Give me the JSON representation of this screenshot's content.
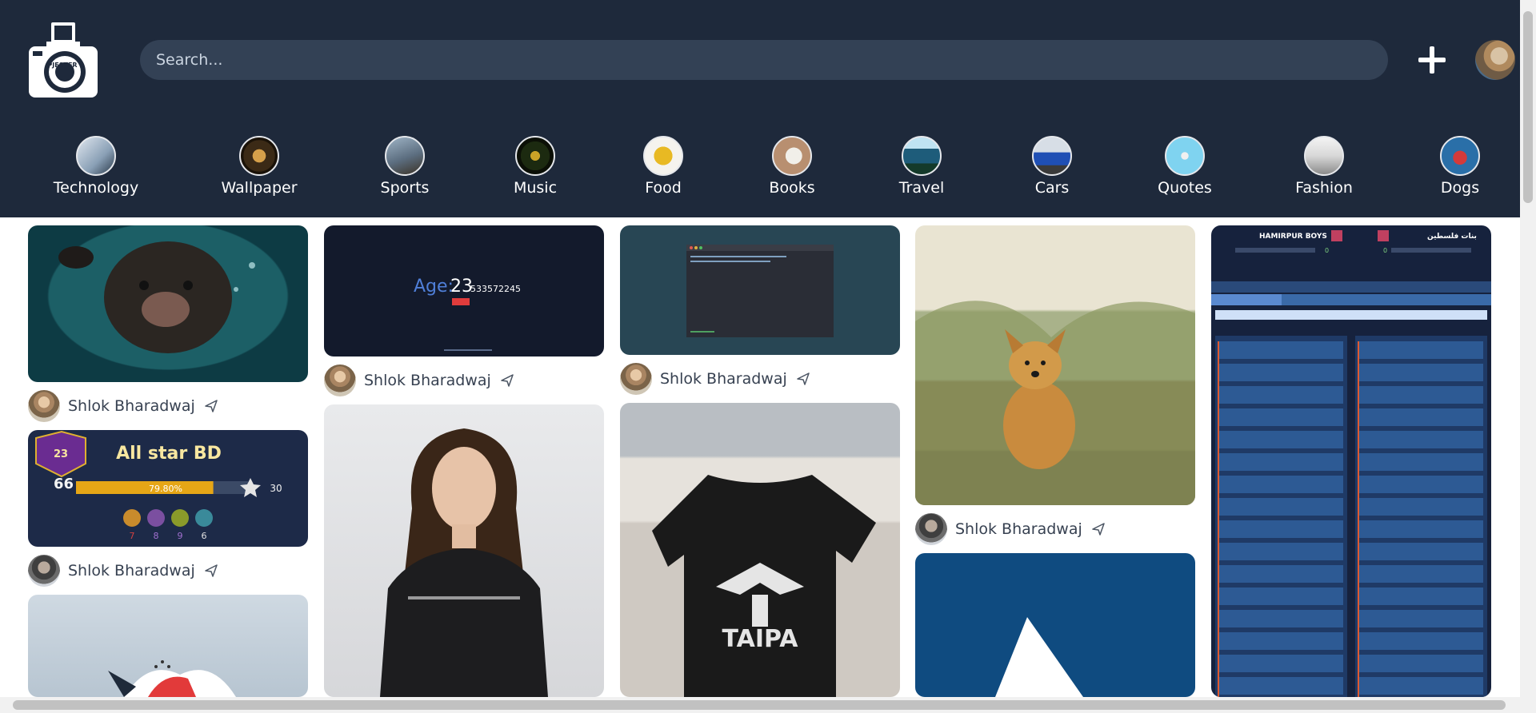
{
  "header": {
    "logo_text": "PJESTER",
    "search_placeholder": "Search...",
    "add_label": "+"
  },
  "categories": [
    {
      "label": "Technology",
      "icon": "technology-thumb"
    },
    {
      "label": "Wallpaper",
      "icon": "wallpaper-thumb"
    },
    {
      "label": "Sports",
      "icon": "sports-thumb"
    },
    {
      "label": "Music",
      "icon": "music-thumb"
    },
    {
      "label": "Food",
      "icon": "food-thumb"
    },
    {
      "label": "Books",
      "icon": "books-thumb"
    },
    {
      "label": "Travel",
      "icon": "travel-thumb"
    },
    {
      "label": "Cars",
      "icon": "cars-thumb"
    },
    {
      "label": "Quotes",
      "icon": "quotes-thumb"
    },
    {
      "label": "Fashion",
      "icon": "fashion-thumb"
    },
    {
      "label": "Dogs",
      "icon": "dogs-thumb"
    }
  ],
  "pins": {
    "dog_underwater": {
      "author": "Shlok Bharadwaj"
    },
    "game_badge": {
      "author": "Shlok Bharadwaj",
      "title": "All star BD",
      "level": "66",
      "level_badge": "23",
      "progress_label": "79.80%",
      "progress": 0.798,
      "right_value": "30",
      "counts": [
        "7",
        "8",
        "9",
        "6"
      ]
    },
    "age_app": {
      "author": "Shlok Bharadwaj",
      "age_label": "Age:",
      "age_int": "23",
      "age_dec": "533572245"
    },
    "terminal": {
      "author": "Shlok Bharadwaj"
    },
    "dog_valley": {
      "author": "Shlok Bharadwaj"
    },
    "war_table": {
      "left_team": "HAMIRPUR BOYS",
      "right_team": "بنات فلسطين",
      "score_left": "0",
      "score_right": "0"
    }
  },
  "colors": {
    "header_bg": "#1e293b",
    "search_bg": "#334155",
    "text_dark": "#374151"
  }
}
